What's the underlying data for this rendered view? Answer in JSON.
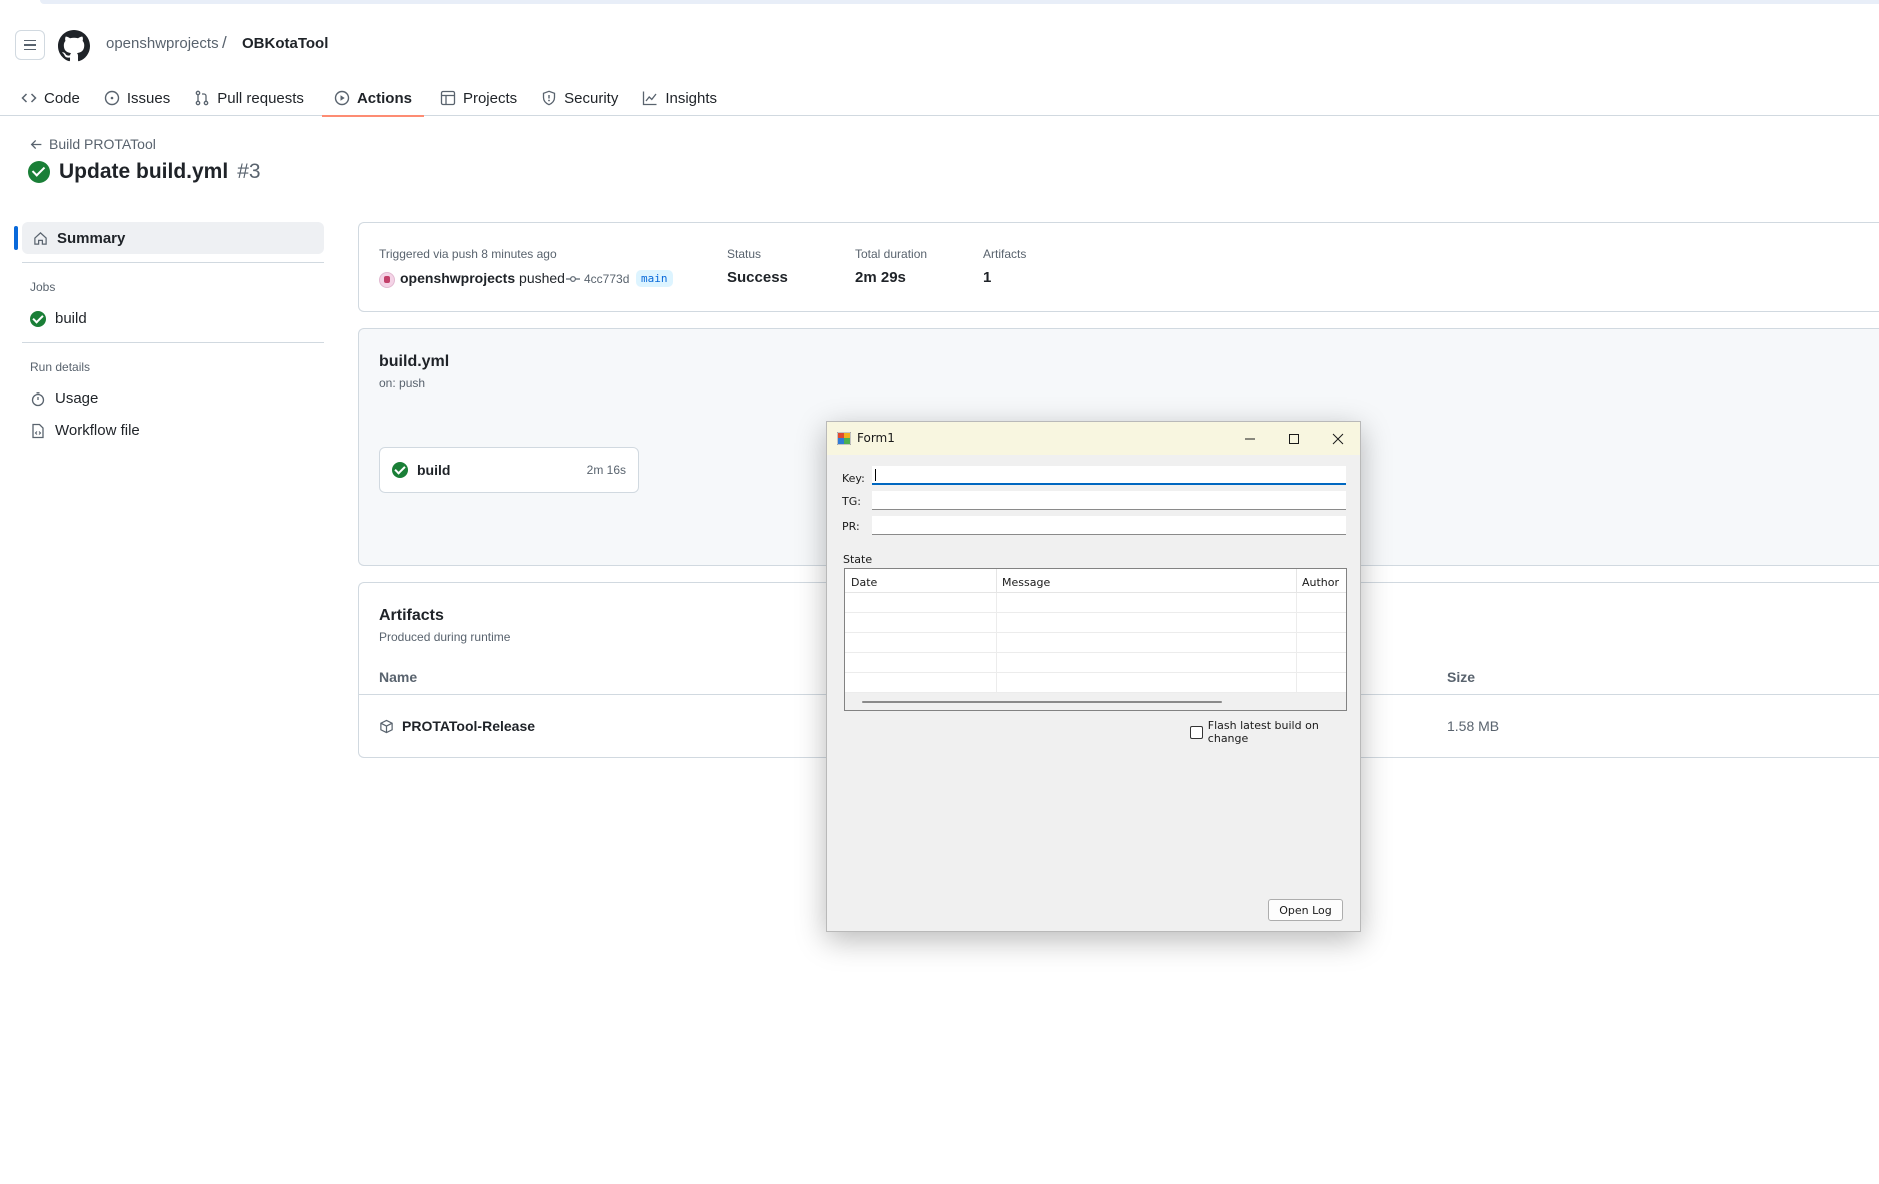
{
  "repo": {
    "owner": "openshwprojects",
    "separator": "/",
    "name": "OBKotaTool"
  },
  "nav": [
    {
      "label": "Code",
      "icon": "code-icon"
    },
    {
      "label": "Issues",
      "icon": "issue-icon"
    },
    {
      "label": "Pull requests",
      "icon": "pull-request-icon"
    },
    {
      "label": "Actions",
      "icon": "play-icon",
      "active": true
    },
    {
      "label": "Projects",
      "icon": "table-icon"
    },
    {
      "label": "Security",
      "icon": "shield-icon"
    },
    {
      "label": "Insights",
      "icon": "graph-icon"
    }
  ],
  "run": {
    "back_label": "Build PROTATool",
    "title": "Update build.yml",
    "number": "#3"
  },
  "sidebar": {
    "summary": "Summary",
    "jobs_heading": "Jobs",
    "job": "build",
    "details_heading": "Run details",
    "usage": "Usage",
    "workflow_file": "Workflow file"
  },
  "trigger": {
    "label": "Triggered via push 8 minutes ago",
    "actor": "openshwprojects",
    "action": "pushed",
    "commit": "4cc773d",
    "branch": "main",
    "status_label": "Status",
    "status_value": "Success",
    "duration_label": "Total duration",
    "duration_value": "2m 29s",
    "artifacts_label": "Artifacts",
    "artifacts_value": "1"
  },
  "workflow": {
    "name": "build.yml",
    "trigger": "on: push",
    "job_name": "build",
    "job_duration": "2m 16s"
  },
  "artifacts": {
    "title": "Artifacts",
    "subtitle": "Produced during runtime",
    "col_name": "Name",
    "col_size": "Size",
    "items": [
      {
        "name": "PROTATool-Release",
        "size": "1.58 MB"
      }
    ]
  },
  "form": {
    "title": "Form1",
    "key_label": "Key:",
    "key_value": "",
    "tg_label": "TG:",
    "tg_value": "",
    "pr_label": "PR:",
    "pr_value": "",
    "state_label": "State",
    "columns": [
      "Date",
      "Message",
      "Author"
    ],
    "checkbox_label": "Flash latest build on change",
    "checkbox_checked": false,
    "open_log": "Open Log"
  },
  "colors": {
    "success": "#1a7f37",
    "link": "#0969da",
    "active_tab": "#fd8c73",
    "win_title": "#f8f6e0"
  }
}
